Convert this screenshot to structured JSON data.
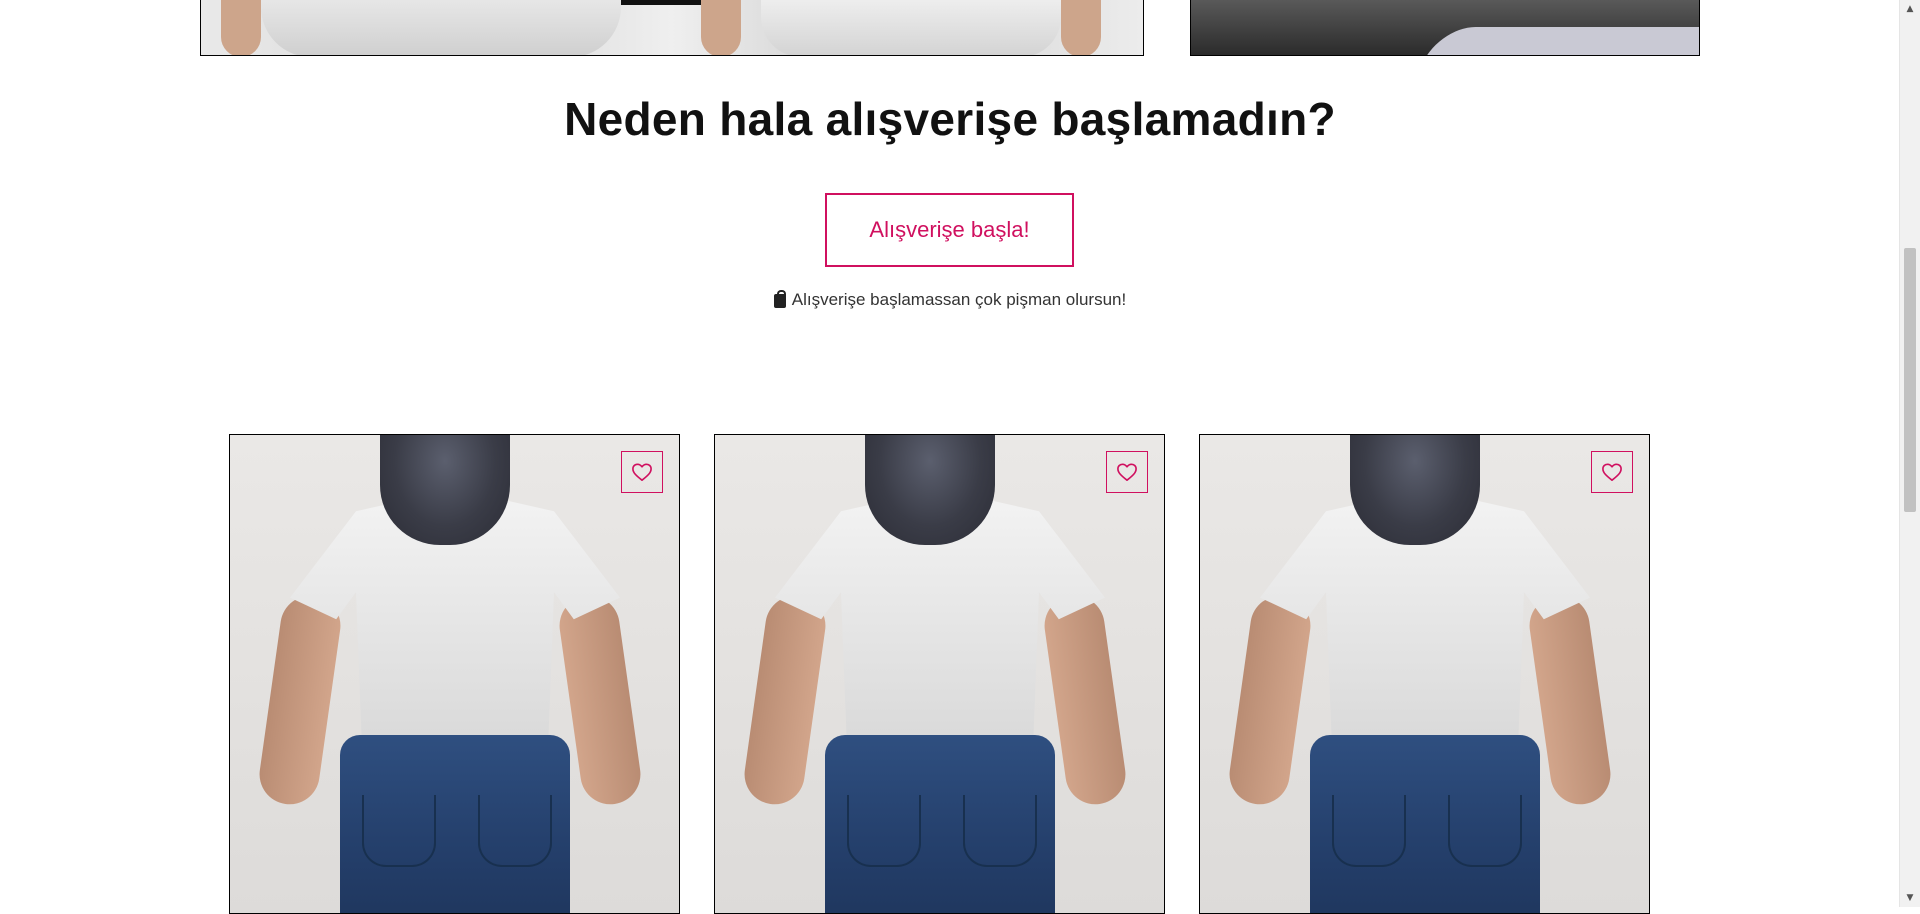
{
  "cta": {
    "title": "Neden hala alışverişe başlamadın?",
    "button_label": "Alışverişe başla!",
    "note": "Alışverişe başlamassan çok pişman olursun!",
    "note_icon": "shopping-bag-icon"
  },
  "products": [
    {
      "wishlist_icon": "heart-icon"
    },
    {
      "wishlist_icon": "heart-icon"
    },
    {
      "wishlist_icon": "heart-icon"
    }
  ],
  "colors": {
    "accent": "#d0105f",
    "text": "#111111",
    "background": "#ffffff"
  }
}
